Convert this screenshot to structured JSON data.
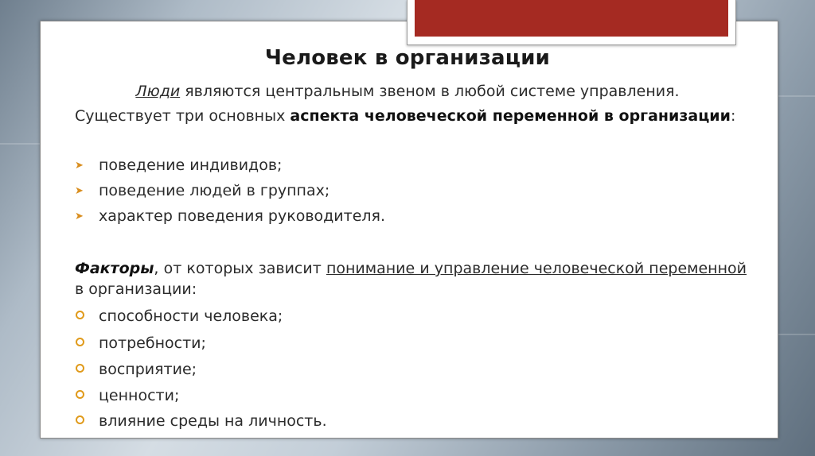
{
  "title": "Человек в организации",
  "intro": {
    "underlined": "Люди",
    "rest": " являются центральным звеном в любой системе управления."
  },
  "aspects": {
    "lead": "Существует три основных",
    "bold": "аспекта человеческой переменной в организации",
    "tail": ":",
    "items": [
      "поведение индивидов;",
      "поведение людей в группах;",
      "характер поведения руководителя."
    ]
  },
  "factors": {
    "bold_italic": "Факторы",
    "text1": ", от которых зависит",
    "underlined": "понимание и управление человеческой переменной",
    "text2": " в организации:",
    "items": [
      "способности человека;",
      "потребности;",
      "восприятие;",
      "ценности;",
      "влияние среды на личность."
    ]
  },
  "colors": {
    "accent": "#a52a22",
    "bullet": "#e09a1a"
  },
  "icons": {
    "arrow_bullet": "chevron-right-icon",
    "circle_bullet": "ring-icon"
  }
}
